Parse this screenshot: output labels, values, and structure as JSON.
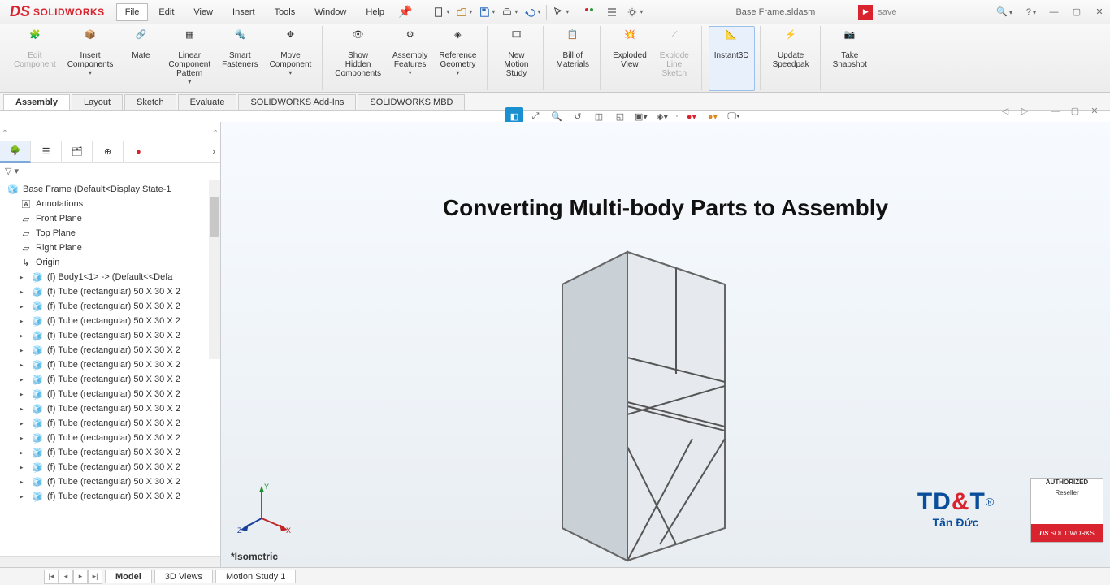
{
  "app": {
    "logo_ds": "DS",
    "logo_text": "SOLIDWORKS"
  },
  "menu": [
    "File",
    "Edit",
    "View",
    "Insert",
    "Tools",
    "Window",
    "Help"
  ],
  "document_title": "Base Frame.sldasm",
  "search_placeholder": "save",
  "ribbon": {
    "edit_component": "Edit\nComponent",
    "insert_components": "Insert\nComponents",
    "mate": "Mate",
    "linear_pattern": "Linear\nComponent\nPattern",
    "smart_fasteners": "Smart\nFasteners",
    "move_component": "Move\nComponent",
    "show_hidden": "Show\nHidden\nComponents",
    "assembly_features": "Assembly\nFeatures",
    "reference_geometry": "Reference\nGeometry",
    "new_motion": "New\nMotion\nStudy",
    "bom": "Bill of\nMaterials",
    "exploded_view": "Exploded\nView",
    "explode_line": "Explode\nLine\nSketch",
    "instant3d": "Instant3D",
    "update_speedpak": "Update\nSpeedpak",
    "take_snapshot": "Take\nSnapshot"
  },
  "cmdtabs": [
    "Assembly",
    "Layout",
    "Sketch",
    "Evaluate",
    "SOLIDWORKS Add-Ins",
    "SOLIDWORKS MBD"
  ],
  "tree": {
    "root": "Base Frame  (Default<Display State-1",
    "annotations": "Annotations",
    "front": "Front Plane",
    "top": "Top Plane",
    "right": "Right Plane",
    "origin": "Origin",
    "body1": "(f) Body1<1> -> (Default<<Defa",
    "tube": "(f) Tube (rectangular) 50 X 30 X 2"
  },
  "graphics": {
    "headline": "Converting Multi-body Parts to Assembly",
    "view_label": "*Isometric",
    "triad": {
      "x": "X",
      "y": "Y",
      "z": "Z"
    }
  },
  "bottom_tabs": [
    "Model",
    "3D Views",
    "Motion Study 1"
  ],
  "reseller": {
    "top": "AUTHORIZED",
    "sub": "Reseller",
    "brand_ds": "DS",
    "brand": "SOLIDWORKS"
  },
  "tdt": {
    "t1": "TD",
    "amp": "&",
    "t2": "T",
    "sub": "Tân Đức",
    "reg": "®"
  }
}
